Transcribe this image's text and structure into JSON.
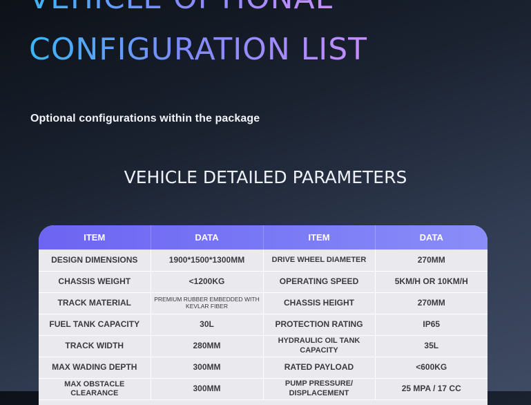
{
  "hero": {
    "line1": "VEHICLE OPTIONAL",
    "line2": "CONFIGURATION LIST"
  },
  "subtitle": "Optional configurations within the package",
  "section_title": "VEHICLE DETAILED PARAMETERS",
  "table": {
    "headers": [
      "ITEM",
      "DATA",
      "ITEM",
      "DATA"
    ],
    "rows": [
      [
        "DESIGN DIMENSIONS",
        "1900*1500*1300MM",
        "DRIVE WHEEL DIAMETER",
        "270MM"
      ],
      [
        "CHASSIS WEIGHT",
        "<1200KG",
        "OPERATING SPEED",
        "5KM/H OR 10KM/H"
      ],
      [
        "TRACK MATERIAL",
        "PREMIUM RUBBER EMBEDDED WITH KEVLAR FIBER",
        "CHASSIS HEIGHT",
        "270MM"
      ],
      [
        "FUEL TANK CAPACITY",
        "30L",
        "PROTECTION RATING",
        "IP65"
      ],
      [
        "TRACK WIDTH",
        "280MM",
        "HYDRAULIC OIL TANK CAPACITY",
        "35L"
      ],
      [
        "MAX WADING DEPTH",
        "300MM",
        "RATED PAYLOAD",
        "<600KG"
      ],
      [
        "MAX OBSTACLE CLEARANCE",
        "300MM",
        "PUMP PRESSURE/ DISPLACEMENT",
        "25 MPA / 17 CC"
      ]
    ]
  }
}
